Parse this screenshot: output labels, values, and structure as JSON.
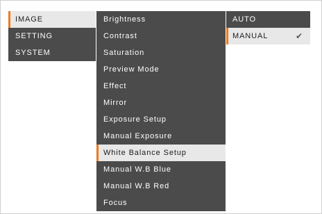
{
  "menu": {
    "categories": [
      {
        "label": "IMAGE",
        "selected": true
      },
      {
        "label": "SETTING",
        "selected": false
      },
      {
        "label": "SYSTEM",
        "selected": false
      }
    ],
    "image_items": [
      "Brightness",
      "Contrast",
      "Saturation",
      "Preview Mode",
      "Effect",
      "Mirror",
      "Exposure Setup",
      "Manual Exposure",
      "White Balance Setup",
      "Manual W.B Blue",
      "Manual W.B Red",
      "Focus"
    ],
    "image_selected": "White Balance Setup",
    "white_balance_options": [
      {
        "label": "AUTO",
        "selected": false
      },
      {
        "label": "MANUAL",
        "selected": true
      }
    ]
  },
  "colors": {
    "menu_bg": "#4b4b4b",
    "highlight_bg": "#e8e8e8",
    "accent": "#ee7a1e"
  }
}
